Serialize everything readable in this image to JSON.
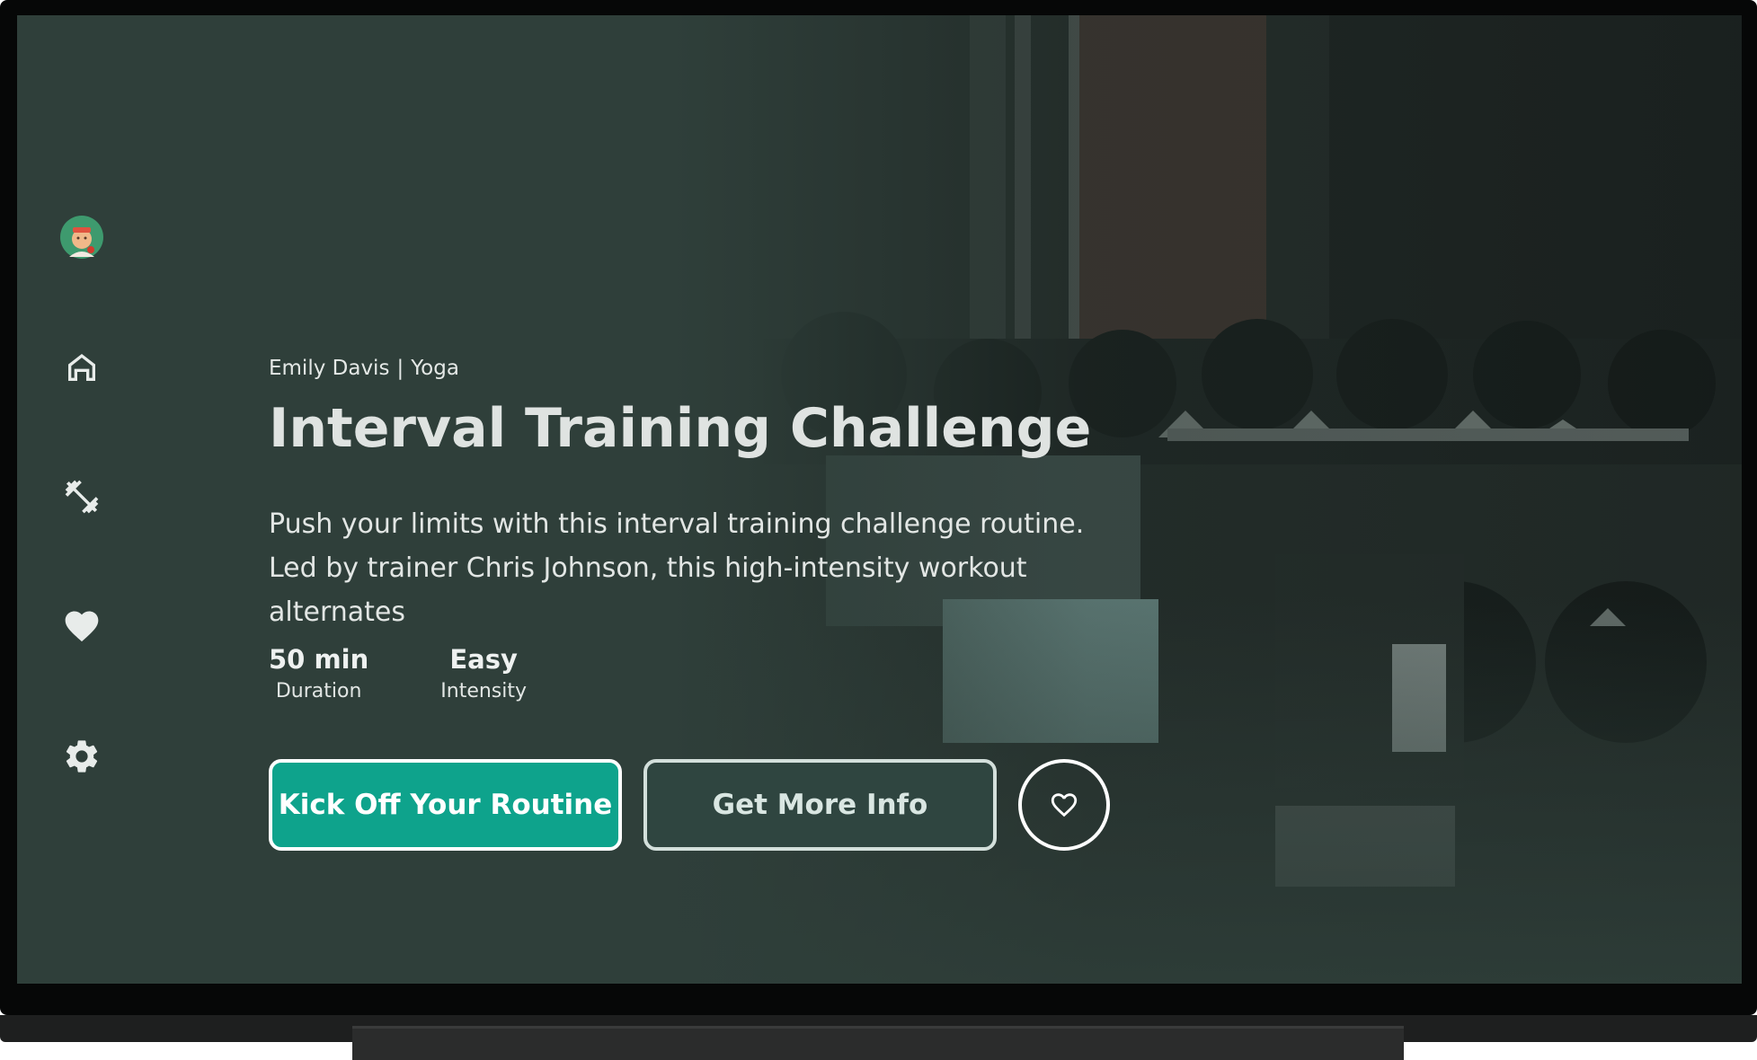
{
  "sidebar": {
    "items": [
      {
        "name": "profile-avatar",
        "icon": "avatar-icon"
      },
      {
        "name": "home",
        "icon": "home-icon"
      },
      {
        "name": "workouts",
        "icon": "dumbbell-icon"
      },
      {
        "name": "favorites",
        "icon": "heart-icon"
      },
      {
        "name": "settings",
        "icon": "gear-icon"
      }
    ]
  },
  "hero": {
    "trainer": "Emily Davis",
    "separator": "|",
    "category": "Yoga",
    "title": "Interval Training Challenge",
    "description": "Push your limits with this interval training challenge routine. Led by trainer Chris Johnson, this high-intensity workout alternates",
    "stats": [
      {
        "value": "50 min",
        "label": "Duration"
      },
      {
        "value": "Easy",
        "label": "Intensity"
      }
    ],
    "primary_button": "Kick Off Your Routine",
    "secondary_button": "Get More Info",
    "favorite_icon": "heart-outline-icon"
  },
  "colors": {
    "accent": "#0ea38c",
    "background": "#2f3f3a"
  }
}
